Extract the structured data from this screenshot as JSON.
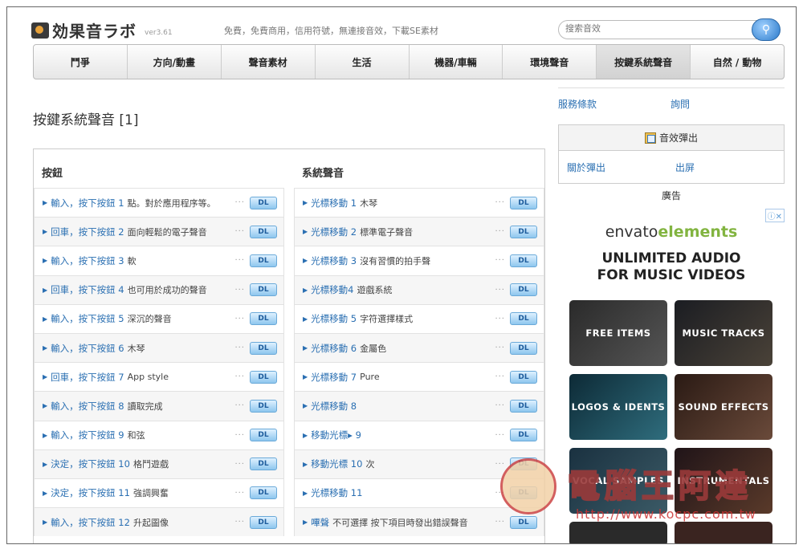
{
  "header": {
    "logo_text": "効果音ラボ",
    "version": "ver3.61",
    "tagline": "免費，免費商用，信用符號，無連接音效，下載SE素材",
    "search_placeholder": "搜索音效"
  },
  "nav": {
    "items": [
      {
        "label": "鬥爭"
      },
      {
        "label": "方向/動畫"
      },
      {
        "label": "聲音素材"
      },
      {
        "label": "生活"
      },
      {
        "label": "機器/車輛"
      },
      {
        "label": "環境聲音"
      },
      {
        "label": "按鍵系統聲音"
      },
      {
        "label": "自然 / 動物"
      }
    ],
    "active_index": 6
  },
  "page": {
    "title": "按鍵系統聲音 [1]"
  },
  "list": {
    "left_header": "按鈕",
    "right_header": "系統聲音",
    "dl_label": "DL",
    "left_rows": [
      {
        "link": "輸入，按下按鈕 1",
        "desc": "點。對於應用程序等。"
      },
      {
        "link": "回車，按下按鈕 2",
        "desc": "面向輕鬆的電子聲音"
      },
      {
        "link": "輸入，按下按鈕 3",
        "desc": "軟"
      },
      {
        "link": "回車，按下按鈕 4",
        "desc": "也可用於成功的聲音"
      },
      {
        "link": "輸入，按下按鈕 5",
        "desc": "深沉的聲音"
      },
      {
        "link": "輸入，按下按鈕 6",
        "desc": "木琴"
      },
      {
        "link": "回車，按下按鈕 7",
        "desc": "App style"
      },
      {
        "link": "輸入，按下按鈕 8",
        "desc": "讀取完成"
      },
      {
        "link": "輸入，按下按鈕 9",
        "desc": "和弦"
      },
      {
        "link": "決定，按下按鈕 10",
        "desc": "格鬥遊戲"
      },
      {
        "link": "決定，按下按鈕 11",
        "desc": "強調興奮"
      },
      {
        "link": "輸入，按下按鈕 12",
        "desc": "升起圖像"
      }
    ],
    "right_rows": [
      {
        "link": "光標移動 1",
        "desc": "木琴"
      },
      {
        "link": "光標移動 2",
        "desc": "標準電子聲音"
      },
      {
        "link": "光標移動 3",
        "desc": "沒有習慣的拍手聲"
      },
      {
        "link": "光標移動4",
        "desc": "遊戲系統"
      },
      {
        "link": "光標移動 5",
        "desc": "字符選擇樣式"
      },
      {
        "link": "光標移動 6",
        "desc": "金屬色"
      },
      {
        "link": "光標移動 7",
        "desc": "Pure"
      },
      {
        "link": "光標移動 8",
        "desc": ""
      },
      {
        "link": "移動光標▸ 9",
        "desc": ""
      },
      {
        "link": "移動光標 10",
        "desc": "次"
      },
      {
        "link": "光標移動 11",
        "desc": ""
      },
      {
        "link": "嗶聲",
        "desc": "不可選擇 按下項目時發出錯誤聲音"
      }
    ]
  },
  "sidebar": {
    "terms": "服務條款",
    "inquiry": "詢問",
    "popup_title": "音效彈出",
    "about_popup": "關於彈出",
    "popup_out": "出屏",
    "ad_label": "廣告"
  },
  "ad": {
    "brand_a": "envato",
    "brand_b": "elements",
    "title_line1": "UNLIMITED AUDIO",
    "title_line2": "FOR MUSIC VIDEOS",
    "tiles": [
      "FREE ITEMS",
      "MUSIC TRACKS",
      "LOGOS & IDENTS",
      "SOUND EFFECTS",
      "VOCAL SAMPLES",
      "INSTRUMENTALS"
    ]
  },
  "watermark": {
    "text": "電腦王阿達",
    "url": "http://www.kocpc.com.tw"
  }
}
